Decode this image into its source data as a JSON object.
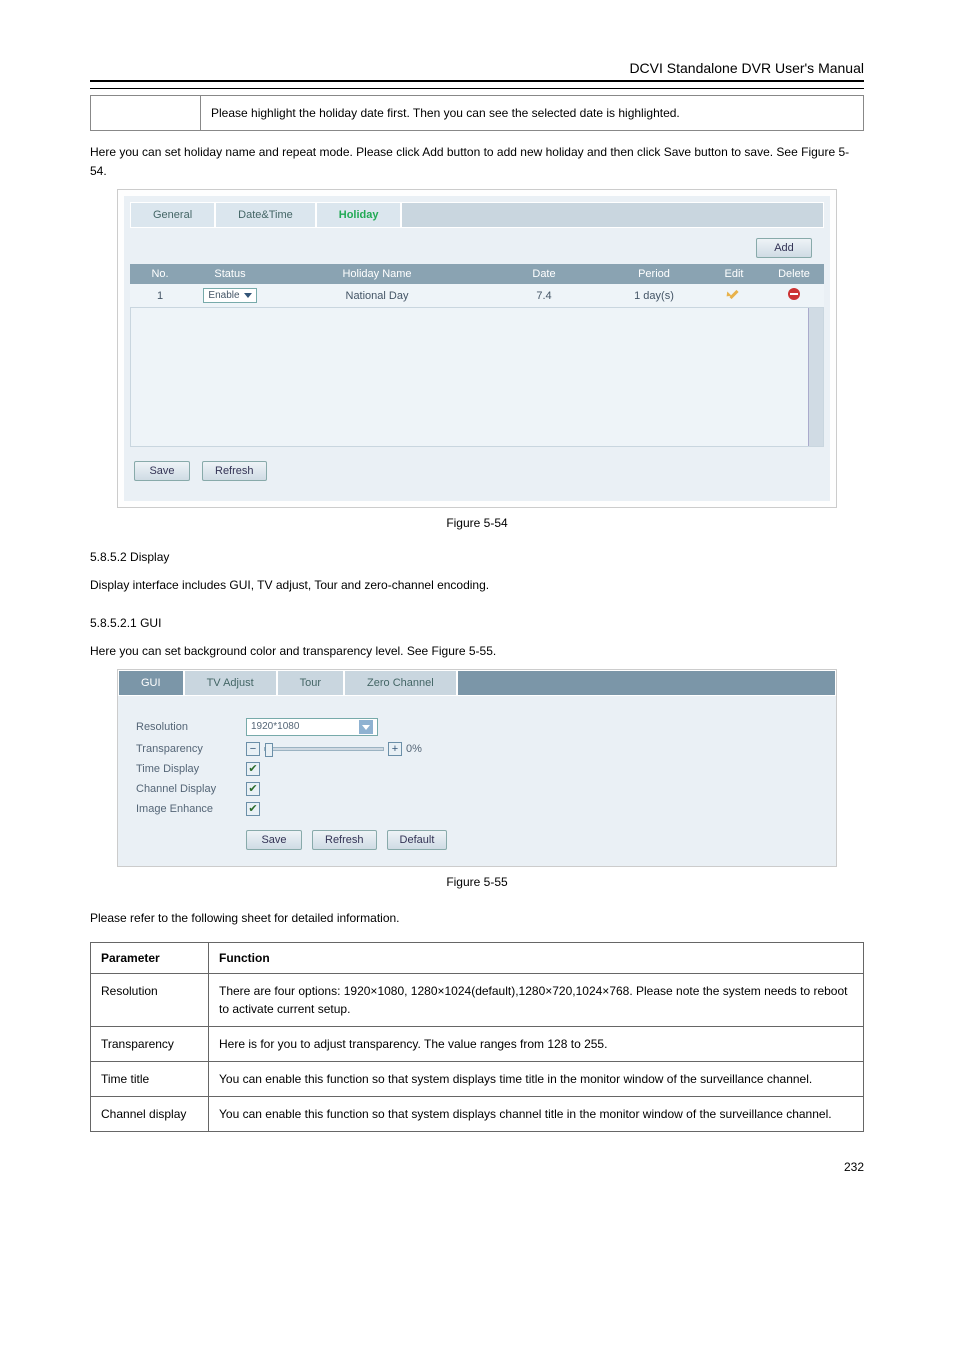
{
  "header": {
    "title": "DCVI Standalone DVR User's Manual"
  },
  "table_top": {
    "col1": "",
    "col2": "Please highlight the holiday date first. Then you can see the selected date is highlighted."
  },
  "intro": "Here you can set holiday name and repeat mode. Please click Add button to add new holiday and then click Save button to save. See Figure 5-54.",
  "shot1": {
    "tabs": {
      "general": "General",
      "datetime": "Date&Time",
      "holiday": "Holiday"
    },
    "buttons": {
      "add": "Add",
      "save": "Save",
      "refresh": "Refresh"
    },
    "cols": {
      "no": "No.",
      "status": "Status",
      "holiday_name": "Holiday Name",
      "date": "Date",
      "period": "Period",
      "edit": "Edit",
      "delete": "Delete"
    },
    "row": {
      "no": "1",
      "status": "Enable",
      "holiday_name": "National Day",
      "date": "7.4",
      "period": "1 day(s)"
    }
  },
  "caption1": "Figure 5-54",
  "sect1": {
    "num": "5.8.5.2",
    "title": "Display"
  },
  "sect1_body": "Display interface includes GUI, TV adjust, Tour and zero-channel encoding.",
  "sect2": {
    "num": "5.8.5.2.1",
    "title": "GUI"
  },
  "sect2_body": "Here you can set background color and transparency level. See Figure 5-55.",
  "shot2": {
    "tabs": {
      "gui": "GUI",
      "tvadj": "TV Adjust",
      "tour": "Tour",
      "zero": "Zero Channel"
    },
    "rows": {
      "resolution": {
        "label": "Resolution",
        "value": "1920*1080"
      },
      "transparency": {
        "label": "Transparency",
        "value": "0%"
      },
      "time": {
        "label": "Time Display"
      },
      "channel": {
        "label": "Channel Display"
      },
      "enhance": {
        "label": "Image Enhance"
      }
    },
    "buttons": {
      "save": "Save",
      "refresh": "Refresh",
      "default": "Default"
    }
  },
  "caption2": "Figure 5-55",
  "sect2_body2": "Please refer to the following sheet for detailed information.",
  "param_table": {
    "h1": "Parameter",
    "h2": "Function",
    "r1": {
      "p": "Resolution",
      "f": "There are four options: 1920×1080, 1280×1024(default),1280×720,1024×768. Please note the system needs to reboot to activate current setup."
    },
    "r2": {
      "p": "Transparency",
      "f": "Here is for you to adjust transparency. The value ranges from 128 to 255."
    },
    "r3": {
      "p": "Time title",
      "f": "You can enable this function so that system displays time title in the monitor window of the surveillance channel."
    },
    "r4": {
      "p": "Channel display",
      "f": "You can enable this function so that system displays channel title in the monitor window of the surveillance channel."
    }
  },
  "footer": {
    "page": "232"
  }
}
